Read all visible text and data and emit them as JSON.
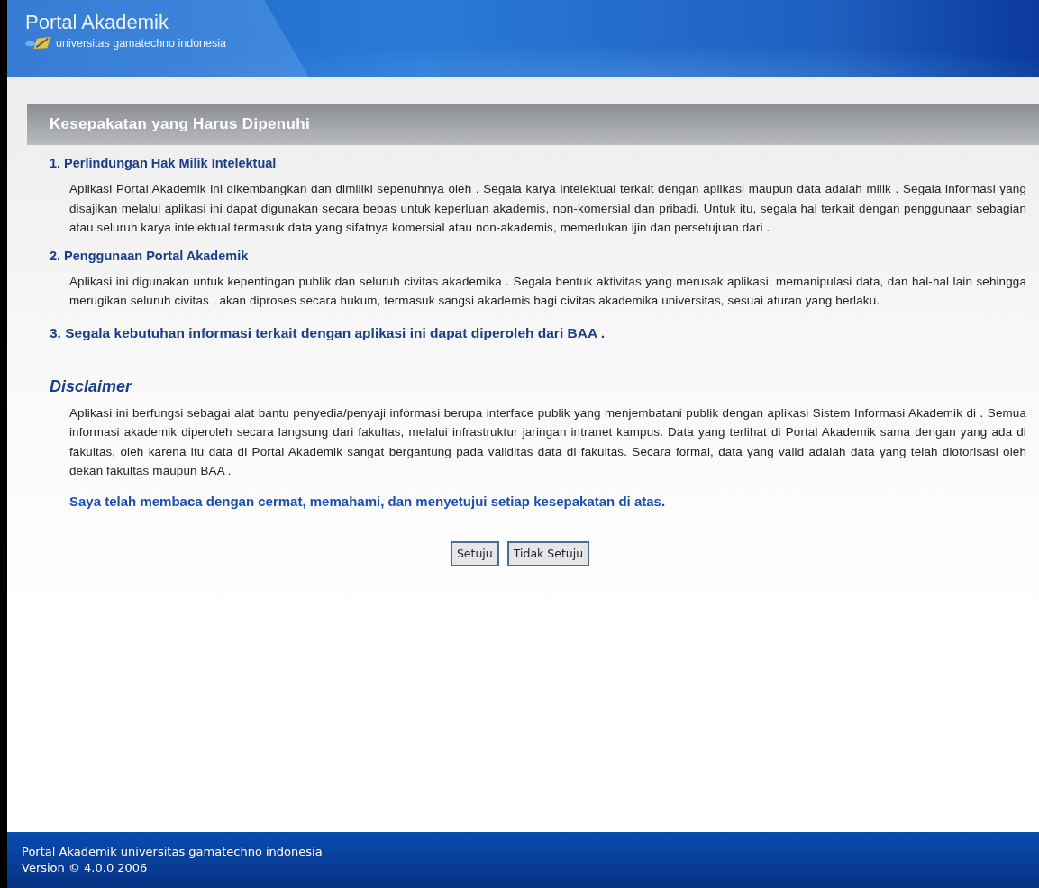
{
  "header": {
    "title": "Portal Akademik",
    "subtitle": "universitas gamatechno indonesia"
  },
  "panel_title": "Kesepakatan yang Harus Dipenuhi",
  "sections": [
    {
      "kind": "clause",
      "heading": "1. Perlindungan Hak Milik Intelektual",
      "text": "Aplikasi Portal Akademik ini dikembangkan dan dimiliki sepenuhnya oleh . Segala karya intelektual terkait dengan aplikasi maupun data adalah milik . Segala informasi yang disajikan melalui aplikasi ini dapat digunakan secara bebas untuk keperluan akademis, non-komersial dan pribadi. Untuk itu, segala hal terkait dengan penggunaan sebagian atau seluruh karya intelektual termasuk data yang sifatnya komersial atau non-akademis, memerlukan ijin dan persetujuan dari ."
    },
    {
      "kind": "clause",
      "heading": "2. Penggunaan Portal Akademik",
      "text": "Aplikasi ini digunakan untuk kepentingan publik dan seluruh civitas akademika . Segala bentuk aktivitas yang merusak aplikasi, memanipulasi data, dan hal-hal lain sehingga merugikan seluruh civitas , akan diproses secara hukum, termasuk sangsi akademis bagi civitas akademika universitas, sesuai aturan yang berlaku."
    },
    {
      "kind": "statement",
      "heading": "3. Segala kebutuhan informasi terkait dengan aplikasi ini dapat diperoleh dari BAA ."
    }
  ],
  "disclaimer": {
    "title": "Disclaimer",
    "text": "Aplikasi ini berfungsi sebagai alat bantu penyedia/penyaji informasi berupa interface publik yang menjembatani publik dengan aplikasi Sistem Informasi Akademik di . Semua informasi akademik diperoleh secara langsung dari fakultas, melalui infrastruktur jaringan intranet kampus. Data yang terlihat di Portal Akademik sama dengan yang ada di fakultas, oleh karena itu data di Portal Akademik sangat bergantung pada validitas data di fakultas. Secara formal, data yang valid adalah data yang telah diotorisasi oleh dekan fakultas maupun BAA ."
  },
  "agreement": "Saya telah membaca dengan cermat, memahami, dan menyetujui setiap kesepakatan di atas.",
  "buttons": [
    "Setuju",
    "Tidak Setuju"
  ],
  "footer": {
    "line_1": "Portal Akademik universitas gamatechno indonesia",
    "line_2": "Version © 4.0.0 2006"
  }
}
